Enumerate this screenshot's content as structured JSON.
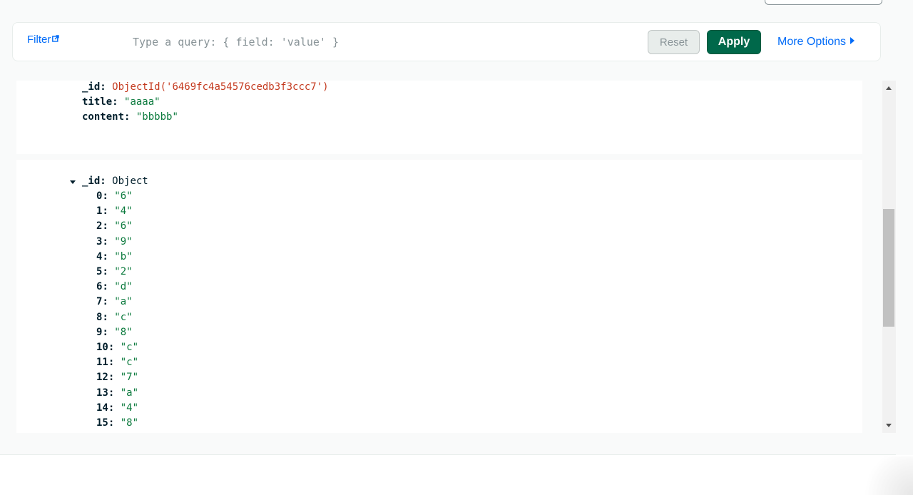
{
  "filter": {
    "label": "Filter",
    "query_placeholder": "Type a query: { field: 'value' }",
    "reset_label": "Reset",
    "apply_label": "Apply",
    "more_options_label": "More Options"
  },
  "documents": [
    {
      "fields": [
        {
          "key": "_id",
          "value": "ObjectId('6469fc4a54576cedb3f3ccc7')",
          "type": "objectid"
        },
        {
          "key": "title",
          "value": "\"aaaa\"",
          "type": "string"
        },
        {
          "key": "content",
          "value": "\"bbbbb\"",
          "type": "string"
        }
      ]
    },
    {
      "expanded_field": {
        "key": "_id",
        "type_label": "Object",
        "expanded": true
      },
      "entries": [
        {
          "key": "0",
          "value": "\"6\""
        },
        {
          "key": "1",
          "value": "\"4\""
        },
        {
          "key": "2",
          "value": "\"6\""
        },
        {
          "key": "3",
          "value": "\"9\""
        },
        {
          "key": "4",
          "value": "\"b\""
        },
        {
          "key": "5",
          "value": "\"2\""
        },
        {
          "key": "6",
          "value": "\"d\""
        },
        {
          "key": "7",
          "value": "\"a\""
        },
        {
          "key": "8",
          "value": "\"c\""
        },
        {
          "key": "9",
          "value": "\"8\""
        },
        {
          "key": "10",
          "value": "\"c\""
        },
        {
          "key": "11",
          "value": "\"c\""
        },
        {
          "key": "12",
          "value": "\"7\""
        },
        {
          "key": "13",
          "value": "\"a\""
        },
        {
          "key": "14",
          "value": "\"4\""
        },
        {
          "key": "15",
          "value": "\"8\""
        }
      ]
    }
  ],
  "colors": {
    "apply_bg": "#00684a",
    "link_blue": "#016bf8",
    "string_green": "#0b7a3d",
    "objectid_red": "#c43a1f"
  },
  "icons": {
    "filter_link": "external-link-icon",
    "more_options": "caret-right-icon",
    "expand": "caret-down-icon"
  }
}
